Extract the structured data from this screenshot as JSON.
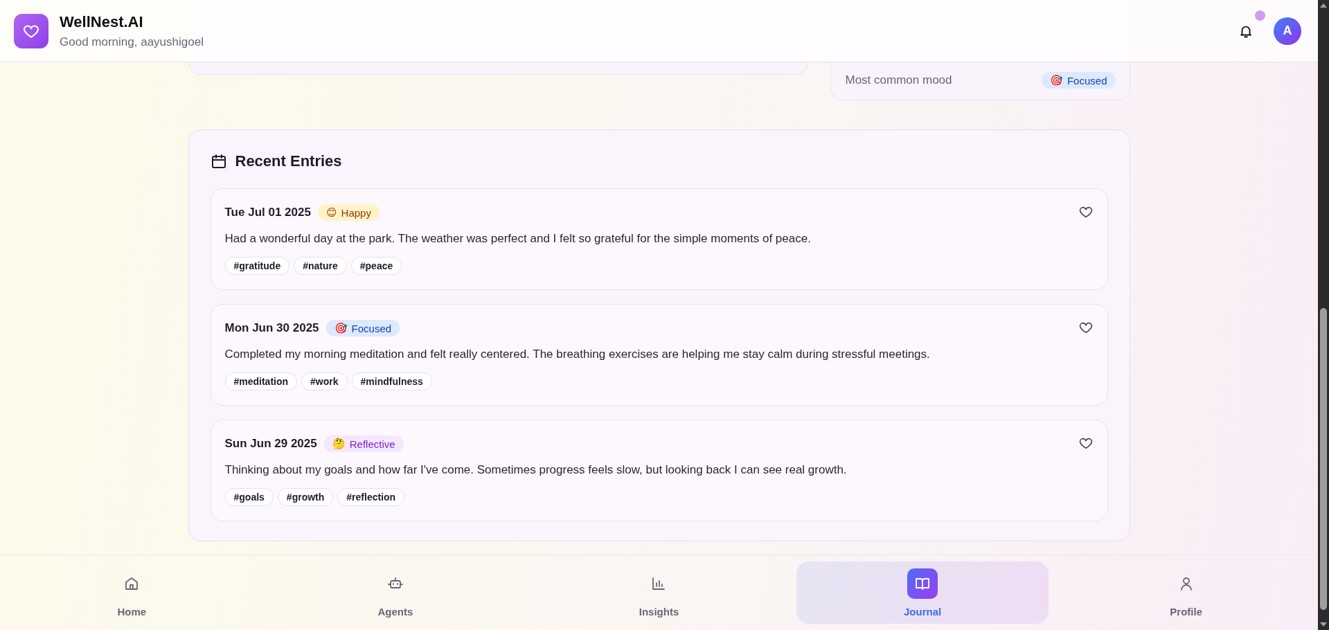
{
  "header": {
    "app_name": "WellNest.AI",
    "greeting": "Good morning, aayushigoel",
    "notification_dot": true,
    "avatar_initial": "A"
  },
  "stats_card": {
    "rows": [
      {
        "label": "Most common mood",
        "mood": {
          "emoji": "🎯",
          "label": "Focused",
          "color": "#dbeafe"
        }
      }
    ]
  },
  "recent_entries": {
    "title": "Recent Entries",
    "entries": [
      {
        "date": "Tue Jul 01 2025",
        "mood": {
          "emoji": "😊",
          "label": "Happy",
          "color": "#fef3c7"
        },
        "text": "Had a wonderful day at the park. The weather was perfect and I felt so grateful for the simple moments of peace.",
        "tags": [
          "#gratitude",
          "#nature",
          "#peace"
        ],
        "favorite": false
      },
      {
        "date": "Mon Jun 30 2025",
        "mood": {
          "emoji": "🎯",
          "label": "Focused",
          "color": "#dbeafe"
        },
        "text": "Completed my morning meditation and felt really centered. The breathing exercises are helping me stay calm during stressful meetings.",
        "tags": [
          "#meditation",
          "#work",
          "#mindfulness"
        ],
        "favorite": false
      },
      {
        "date": "Sun Jun 29 2025",
        "mood": {
          "emoji": "🤔",
          "label": "Reflective",
          "color": "#f3e8ff"
        },
        "text": "Thinking about my goals and how far I've come. Sometimes progress feels slow, but looking back I can see real growth.",
        "tags": [
          "#goals",
          "#growth",
          "#reflection"
        ],
        "favorite": false
      }
    ]
  },
  "bottom_nav": [
    {
      "label": "Home",
      "kind": "home",
      "selected": false
    },
    {
      "label": "Agents",
      "kind": "bot",
      "selected": false
    },
    {
      "label": "Insights",
      "kind": "chart",
      "selected": false
    },
    {
      "label": "Journal",
      "kind": "book",
      "selected": true
    },
    {
      "label": "Profile",
      "kind": "user",
      "selected": false
    }
  ]
}
